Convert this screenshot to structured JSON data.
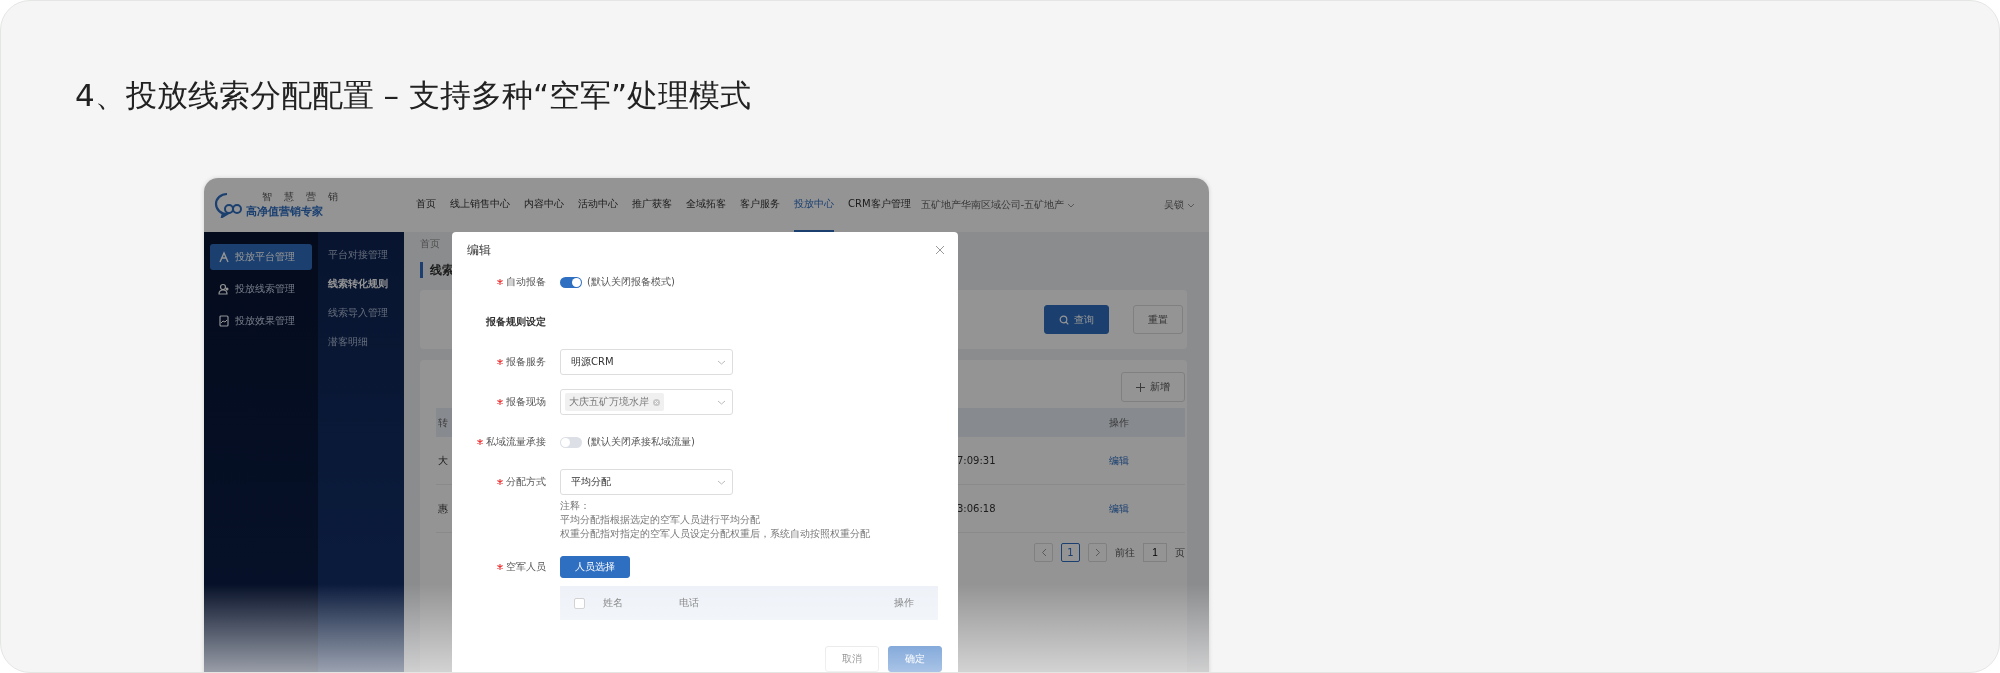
{
  "slide_title": "4、投放线索分配配置 – 支持多种“空军”处理模式",
  "app": {
    "logo": {
      "tagline": [
        "智",
        "慧",
        "营",
        "销"
      ],
      "name": "高净值营销专家"
    },
    "nav": [
      {
        "label": "首页",
        "selected": false
      },
      {
        "label": "线上销售中心",
        "selected": false
      },
      {
        "label": "内容中心",
        "selected": false
      },
      {
        "label": "活动中心",
        "selected": false
      },
      {
        "label": "推广获客",
        "selected": false
      },
      {
        "label": "全域拓客",
        "selected": false
      },
      {
        "label": "客户服务",
        "selected": false
      },
      {
        "label": "投放中心",
        "selected": true
      },
      {
        "label": "CRM客户管理",
        "selected": false
      }
    ],
    "org_selector": "五矿地产华南区域公司-五矿地产",
    "user": "吴锁",
    "sidebar": [
      {
        "label": "投放平台管理",
        "selected": true
      },
      {
        "label": "投放线索管理",
        "selected": false
      },
      {
        "label": "投放效果管理",
        "selected": false
      }
    ],
    "submenu": [
      {
        "label": "平台对接管理",
        "selected": false
      },
      {
        "label": "线索转化规则",
        "selected": true
      },
      {
        "label": "线索导入管理",
        "selected": false
      },
      {
        "label": "潜客明细",
        "selected": false
      }
    ],
    "breadcrumb": "首页",
    "page_title": "线索",
    "search_button": "查询",
    "reset_button": "重置",
    "add_button": "新增",
    "table": {
      "columns": [
        "转",
        "操作"
      ],
      "rows": [
        {
          "column_1": "大",
          "time": "7:09:31",
          "action": "编辑"
        },
        {
          "column_1": "惠",
          "time": "3:06:18",
          "action": "编辑"
        }
      ]
    },
    "pagination": {
      "pages": [
        {
          "label": "1",
          "selected": true
        }
      ],
      "goto_label": "前往",
      "goto_value": "1",
      "suffix": "页"
    }
  },
  "modal": {
    "title": "编辑",
    "auto_report": {
      "label": "自动报备",
      "required": true,
      "on": true,
      "hint": "(默认关闭报备模式)"
    },
    "section_title": "报备规则设定",
    "report_service": {
      "label": "报备服务",
      "required": true,
      "value": "明源CRM"
    },
    "report_site": {
      "label": "报备现场",
      "required": true,
      "tags": [
        "大庆五矿万境水岸"
      ]
    },
    "private_traffic": {
      "label": "私域流量承接",
      "required": true,
      "on": false,
      "hint": "(默认关闭承接私域流量)"
    },
    "distribution": {
      "label": "分配方式",
      "required": true,
      "value": "平均分配"
    },
    "notes": [
      "注释：",
      "平均分配指根据选定的空军人员进行平均分配",
      "权重分配指对指定的空军人员设定分配权重后，系统自动按照权重分配"
    ],
    "staff": {
      "label": "空军人员",
      "required": true,
      "button": "人员选择",
      "checked": false,
      "columns": [
        "姓名",
        "电话",
        "操作"
      ]
    },
    "footer_buttons": [
      "取消",
      "确定"
    ]
  }
}
